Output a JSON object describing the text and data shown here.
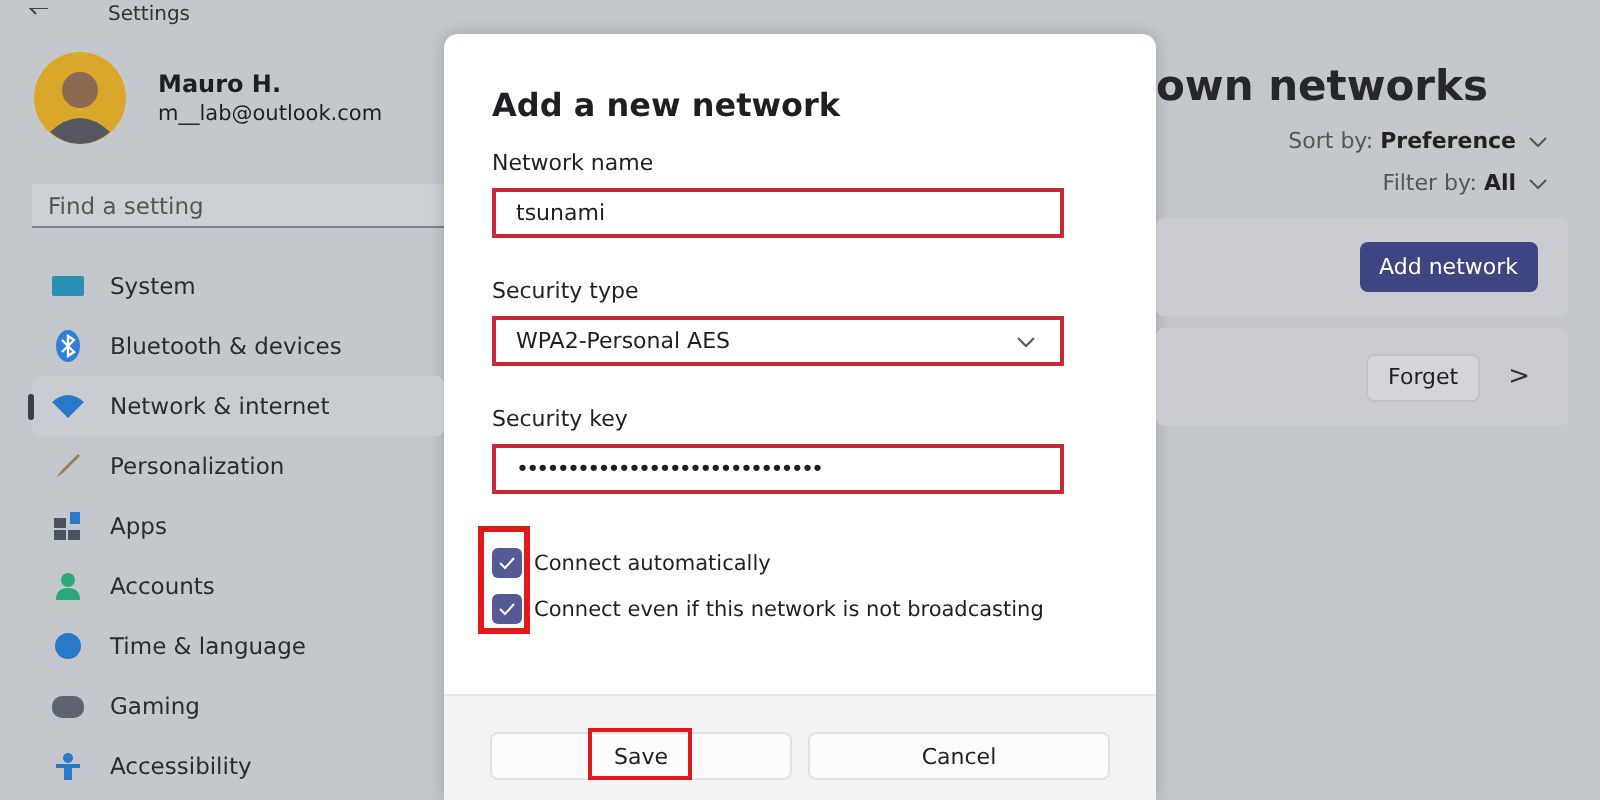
{
  "window": {
    "title": "Settings"
  },
  "account": {
    "name": "Mauro H.",
    "email": "m__lab@outlook.com"
  },
  "search": {
    "placeholder": "Find a setting"
  },
  "sidebar": {
    "items": [
      {
        "label": "System",
        "selected": false
      },
      {
        "label": "Bluetooth & devices",
        "selected": false
      },
      {
        "label": "Network & internet",
        "selected": true
      },
      {
        "label": "Personalization",
        "selected": false
      },
      {
        "label": "Apps",
        "selected": false
      },
      {
        "label": "Accounts",
        "selected": false
      },
      {
        "label": "Time & language",
        "selected": false
      },
      {
        "label": "Gaming",
        "selected": false
      },
      {
        "label": "Accessibility",
        "selected": false
      }
    ]
  },
  "page": {
    "title": "own networks",
    "sort": {
      "label": "Sort by:",
      "value": "Preference"
    },
    "filter": {
      "label": "Filter by:",
      "value": "All"
    },
    "add_button": "Add network",
    "forget_button": "Forget",
    "chevron": ">"
  },
  "dialog": {
    "title": "Add a new network",
    "fields": [
      {
        "kind": "text",
        "label": "Network name",
        "value": "tsunami",
        "highlighted": true
      },
      {
        "kind": "select",
        "label": "Security type",
        "value": "WPA2-Personal AES",
        "highlighted": true
      },
      {
        "kind": "password",
        "label": "Security key",
        "value": "••••••••••••••••••••••••••••••",
        "highlighted": true
      }
    ],
    "checkboxes_highlighted": true,
    "checkboxes": [
      {
        "label": "Connect automatically",
        "checked": true
      },
      {
        "label": "Connect even if this network is not broadcasting",
        "checked": true
      }
    ],
    "buttons": [
      {
        "label": "Save",
        "primary": false,
        "highlighted": true
      },
      {
        "label": "Cancel",
        "primary": false,
        "highlighted": false
      }
    ]
  }
}
